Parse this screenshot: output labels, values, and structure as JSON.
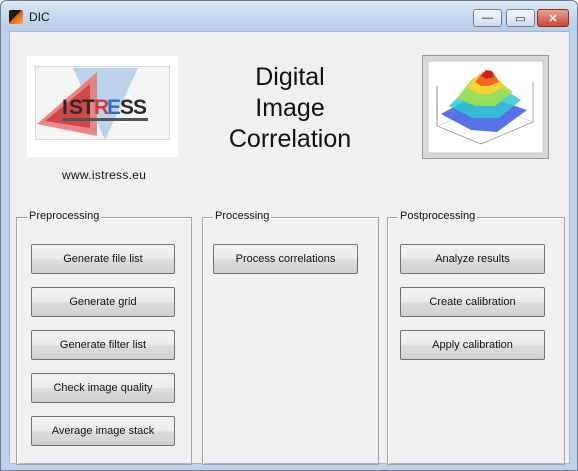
{
  "window": {
    "title": "DIC",
    "controls": {
      "minimize": "—",
      "maximize": "▭",
      "close": "✕"
    }
  },
  "header": {
    "title_lines": [
      "Digital",
      "Image",
      "Correlation"
    ],
    "website": "www.istress.eu",
    "logo_text": "ISTRESS"
  },
  "panels": {
    "preprocessing": {
      "title": "Preprocessing",
      "buttons": [
        "Generate file list",
        "Generate grid",
        "Generate filter list",
        "Check image quality",
        "Average image stack"
      ]
    },
    "processing": {
      "title": "Processing",
      "buttons": [
        "Process correlations"
      ]
    },
    "postprocessing": {
      "title": "Postprocessing",
      "buttons": [
        "Analyze results",
        "Create calibration",
        "Apply calibration"
      ]
    }
  },
  "colors": {
    "titlebar": "#c5d8ee",
    "client_bg": "#f0f0f0",
    "close_button": "#c74a33",
    "logo_red": "#d23a3a",
    "logo_blue": "#2d6fc1"
  }
}
